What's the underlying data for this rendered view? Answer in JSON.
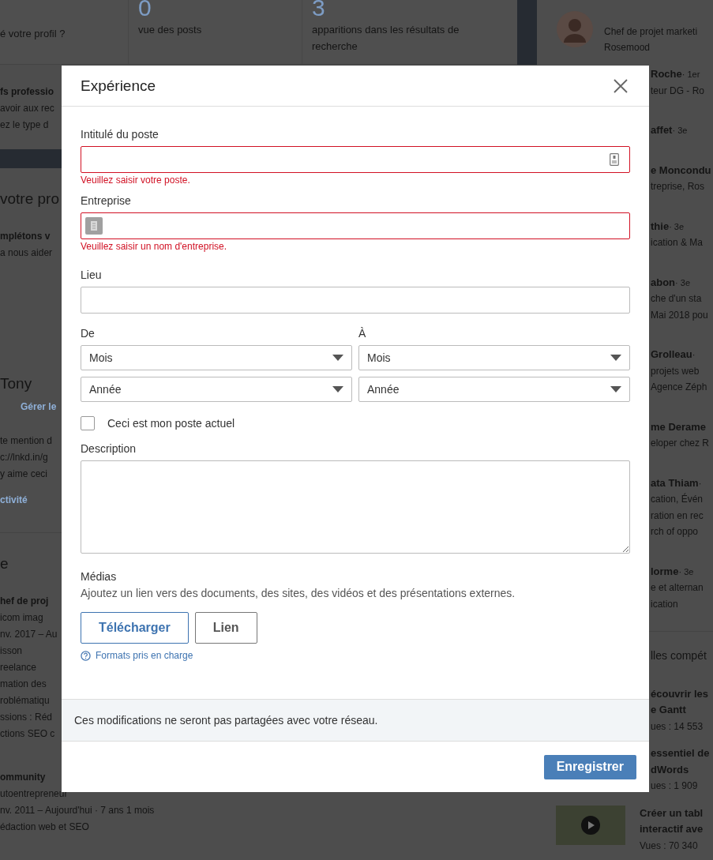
{
  "background": {
    "stats": [
      {
        "label": "é votre profil ?"
      },
      {
        "number": "0",
        "label": "vue des posts"
      },
      {
        "number": "3",
        "label": "apparitions dans les résultats de recherche"
      }
    ],
    "left_sections": [
      {
        "kind": "text",
        "subtitle": "fs professio",
        "lines": [
          "avoir aux rec",
          "ez le type d"
        ]
      },
      {
        "kind": "bar"
      },
      {
        "kind": "text",
        "title": "votre pro",
        "subtitle": "mplétons v",
        "lines": [
          "a nous aider"
        ]
      },
      {
        "kind": "text",
        "title": "Tony",
        "link": "Gérer le",
        "lines": [
          "te mention d",
          "c://lnkd.in/g",
          "y aime ceci"
        ],
        "footer_link": "ctivité"
      },
      {
        "kind": "divider"
      },
      {
        "kind": "text",
        "title": "e",
        "subtitle": "hef de proj",
        "lines": [
          "icom imag",
          "nv. 2017 – Au",
          "isson",
          "reelance",
          "mation des",
          "roblématiqu",
          "ssions : Réd",
          "ctions SEO c"
        ]
      },
      {
        "kind": "text",
        "subtitle": "ommunity",
        "lines": [
          "utoentrepreneur",
          "nv. 2011 – Aujourd'hui · 7 ans 1 mois",
          "édaction web et SEO"
        ]
      }
    ],
    "right": {
      "top_person": {
        "lines": [
          "Chef de projet marketi",
          "Rosemood"
        ]
      },
      "people": [
        {
          "name": "Roche",
          "degree": "· 1er",
          "lines": [
            "teur DG - Ro"
          ]
        },
        {
          "name": "affet",
          "degree": "· 3e"
        },
        {
          "name": "e Moncondu",
          "lines": [
            "treprise, Ros"
          ]
        },
        {
          "name": "thie",
          "degree": "· 3e",
          "lines": [
            "ication & Ma"
          ]
        },
        {
          "name": "abon",
          "degree": "· 3e",
          "lines": [
            "che d'un sta",
            "Mai 2018 pou"
          ]
        },
        {
          "name": "Grolleau",
          "degree": "·",
          "lines": [
            "projets web",
            "Agence Zéph"
          ]
        },
        {
          "name": "me Derame",
          "lines": [
            "eloper chez R"
          ]
        },
        {
          "name": "ata Thiam",
          "degree": "·",
          "lines": [
            "cation, Évén",
            "ration en rec",
            "rch of oppo"
          ]
        },
        {
          "name": "lorme",
          "degree": "· 3e",
          "lines": [
            "e et alternan",
            "ication"
          ]
        }
      ],
      "heading": "lles compét",
      "courses": [
        {
          "kind": "text",
          "title": [
            "écouvrir les",
            "e Gantt"
          ],
          "views": "ues : 14 553"
        },
        {
          "kind": "text",
          "title": [
            "essentiel de",
            "dWords"
          ],
          "views": "ues : 1 909"
        },
        {
          "kind": "video",
          "title": [
            "Créer un tabl",
            "interactif ave"
          ],
          "views": "Vues : 70 340"
        }
      ]
    }
  },
  "dialog": {
    "title": "Expérience",
    "fields": [
      {
        "label": "Intitulé du poste",
        "kind": "badge",
        "invalid": true,
        "error": "Veuillez saisir votre poste."
      },
      {
        "label": "Entreprise",
        "kind": "company",
        "invalid": true,
        "error": "Veuillez saisir un nom d'entreprise."
      },
      {
        "label": "Lieu",
        "kind": "plain",
        "invalid": false
      }
    ],
    "dates": [
      {
        "label": "De",
        "month": "Mois",
        "year": "Année"
      },
      {
        "label": "À",
        "month": "Mois",
        "year": "Année"
      }
    ],
    "current": {
      "label": "Ceci est mon poste actuel",
      "checked": false
    },
    "description": {
      "label": "Description"
    },
    "media": {
      "label": "Médias",
      "hint": "Ajoutez un lien vers des documents, des sites, des vidéos et des présentations externes.",
      "buttons": [
        {
          "label": "Télécharger",
          "kind": "primary"
        },
        {
          "label": "Lien",
          "kind": "secondary"
        }
      ],
      "formats_link": "Formats pris en charge"
    },
    "notice": "Ces modifications ne seront pas partagées avec votre réseau.",
    "save": "Enregistrer"
  }
}
